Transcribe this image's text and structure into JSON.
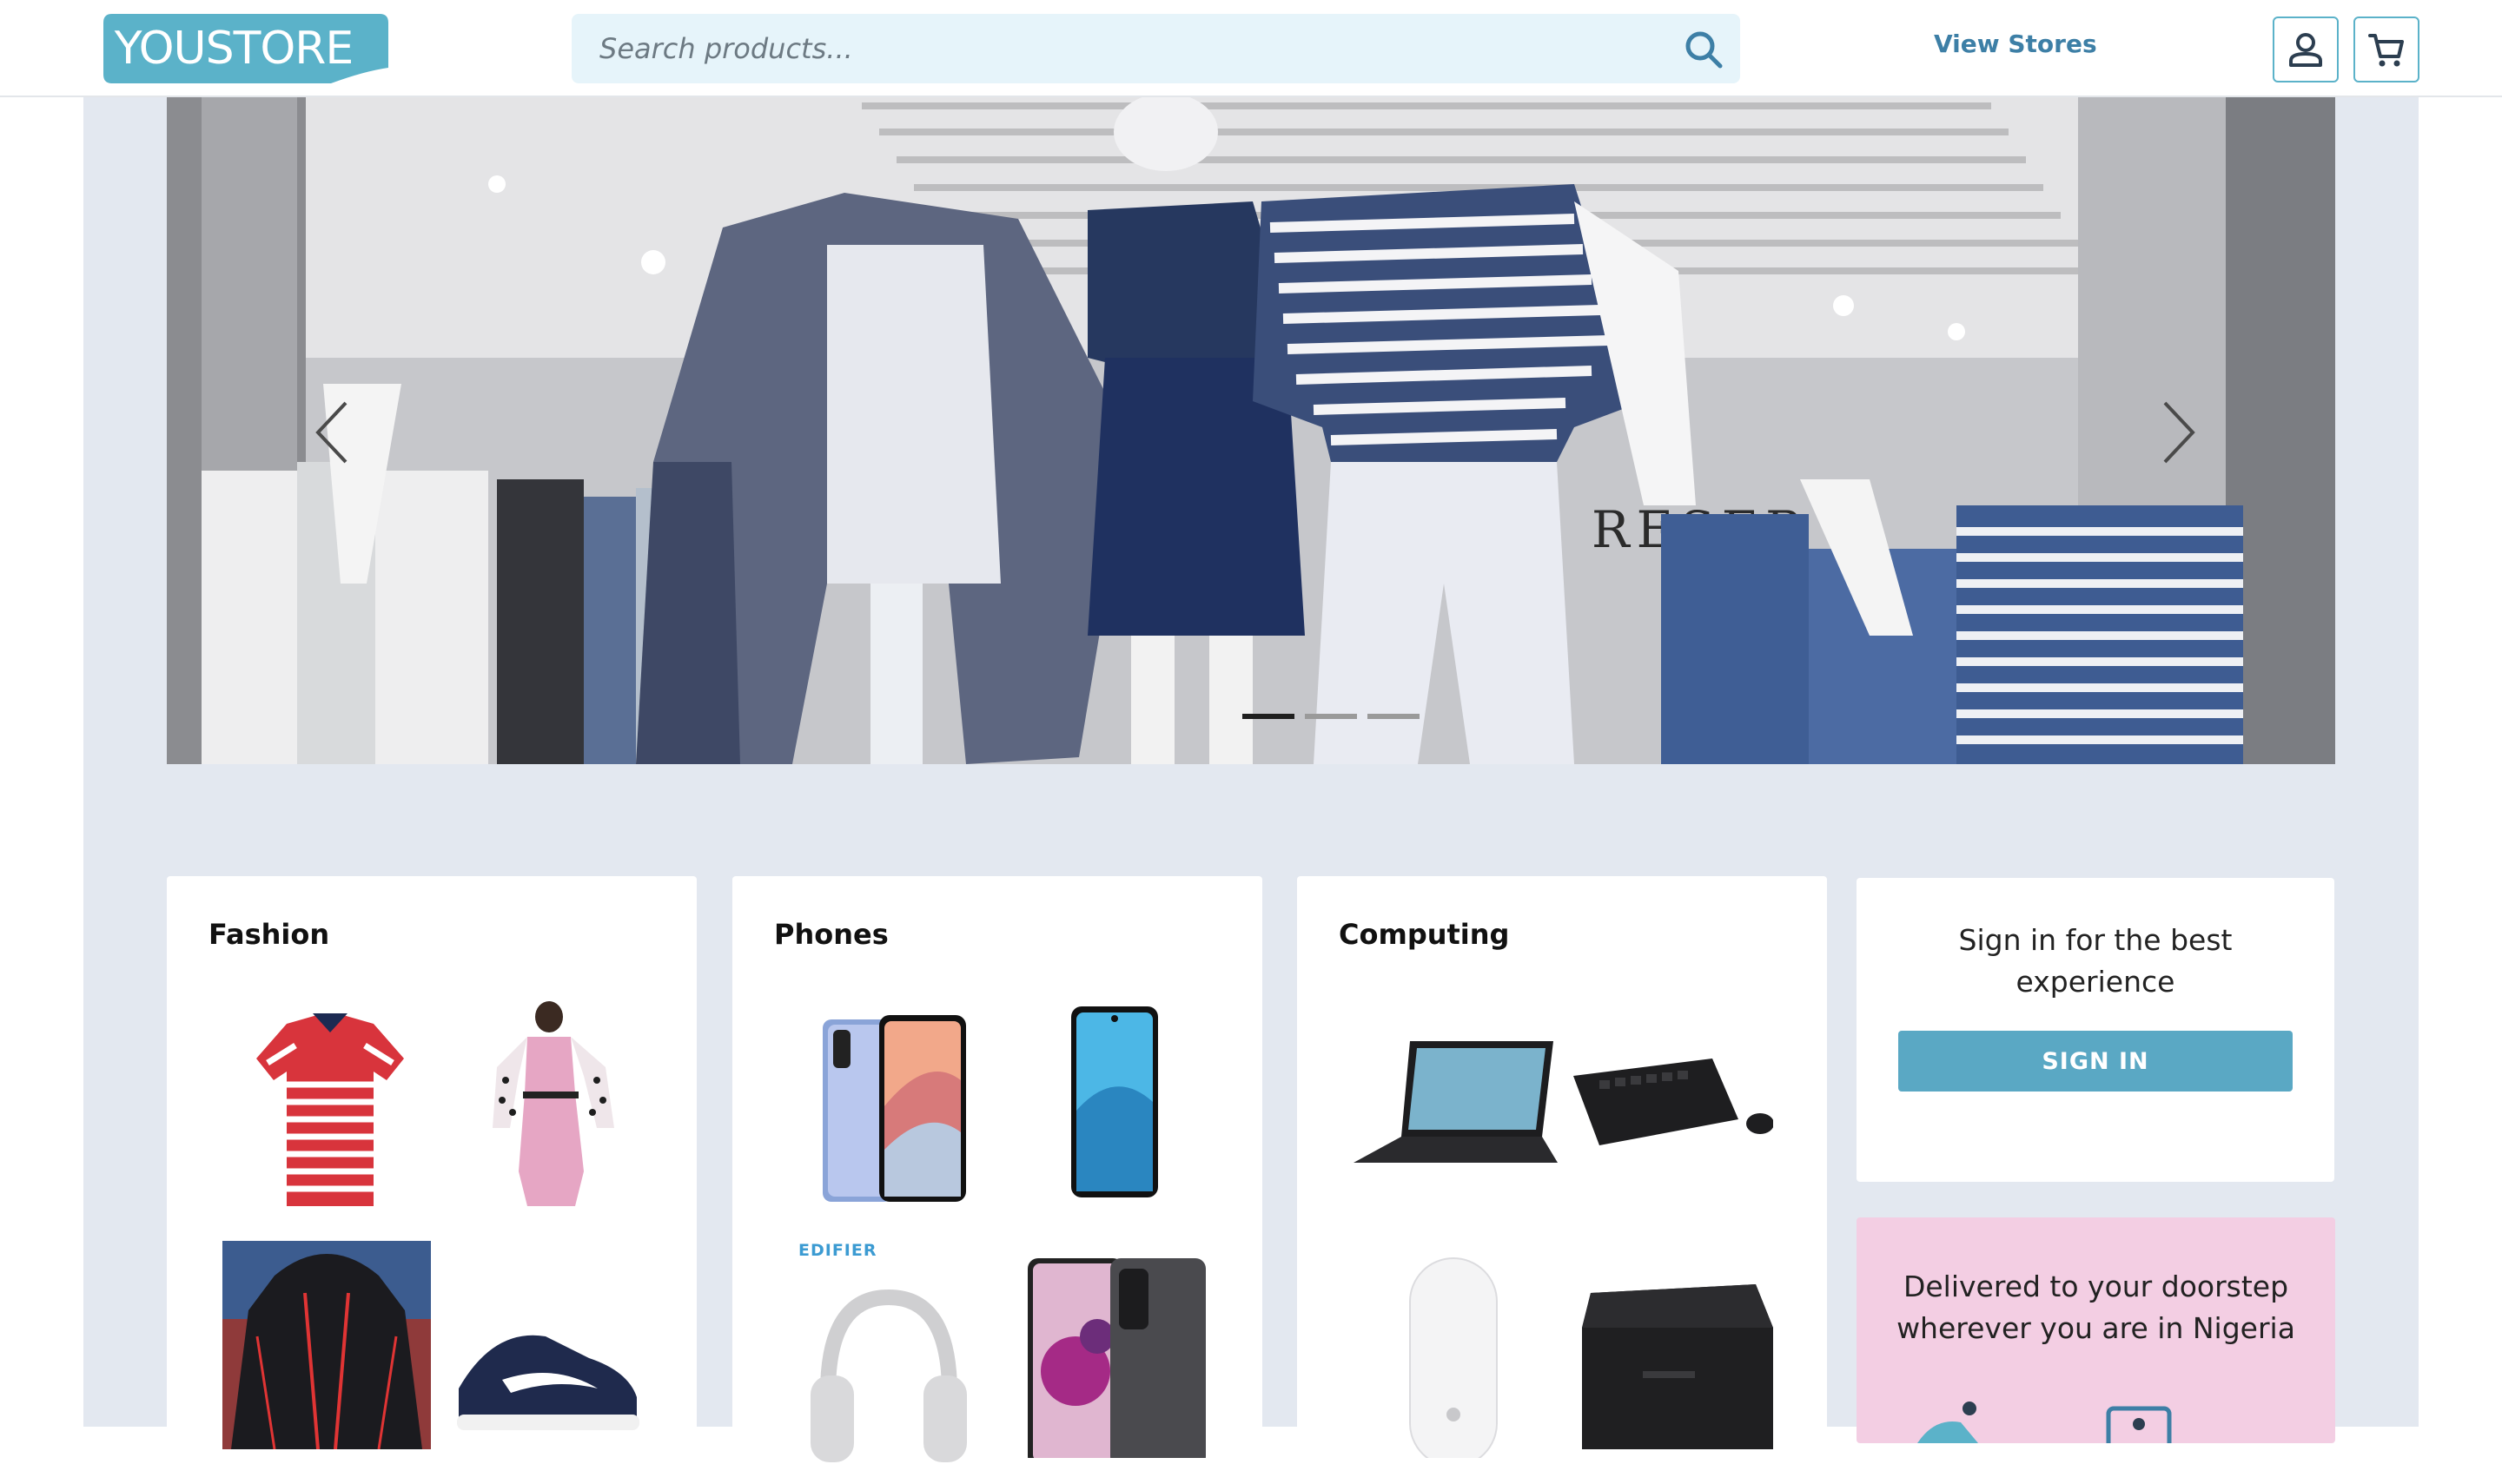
{
  "header": {
    "logo_text": "YOUSTORE",
    "search_placeholder": "Search products...",
    "view_stores_label": "View Stores",
    "account_icon": "account-icon",
    "cart_icon": "cart-icon",
    "brand_color": "#5bb2c9"
  },
  "carousel": {
    "slide_count": 3,
    "active_slide": 1,
    "storefront_sign": "RESER  D"
  },
  "categories": [
    {
      "title": "Fashion",
      "items": [
        "polo-shirt",
        "pink-dress",
        "hoodie",
        "sneakers"
      ]
    },
    {
      "title": "Phones",
      "items": [
        "vivo-phone",
        "infinix-phone",
        "edifier-headphones",
        "xiaomi-phones"
      ],
      "brand_label": "EDIFIER"
    },
    {
      "title": "Computing",
      "items": [
        "laptop",
        "keyboard-mouse",
        "magic-mouse",
        "printer"
      ]
    }
  ],
  "signin": {
    "message": "Sign in for the best experience",
    "button_label": "SIGN IN",
    "button_color": "#5aa8c4"
  },
  "delivery": {
    "message": "Delivered to your doorstep wherever you are in Nigeria",
    "background_color": "#f3cee3"
  }
}
